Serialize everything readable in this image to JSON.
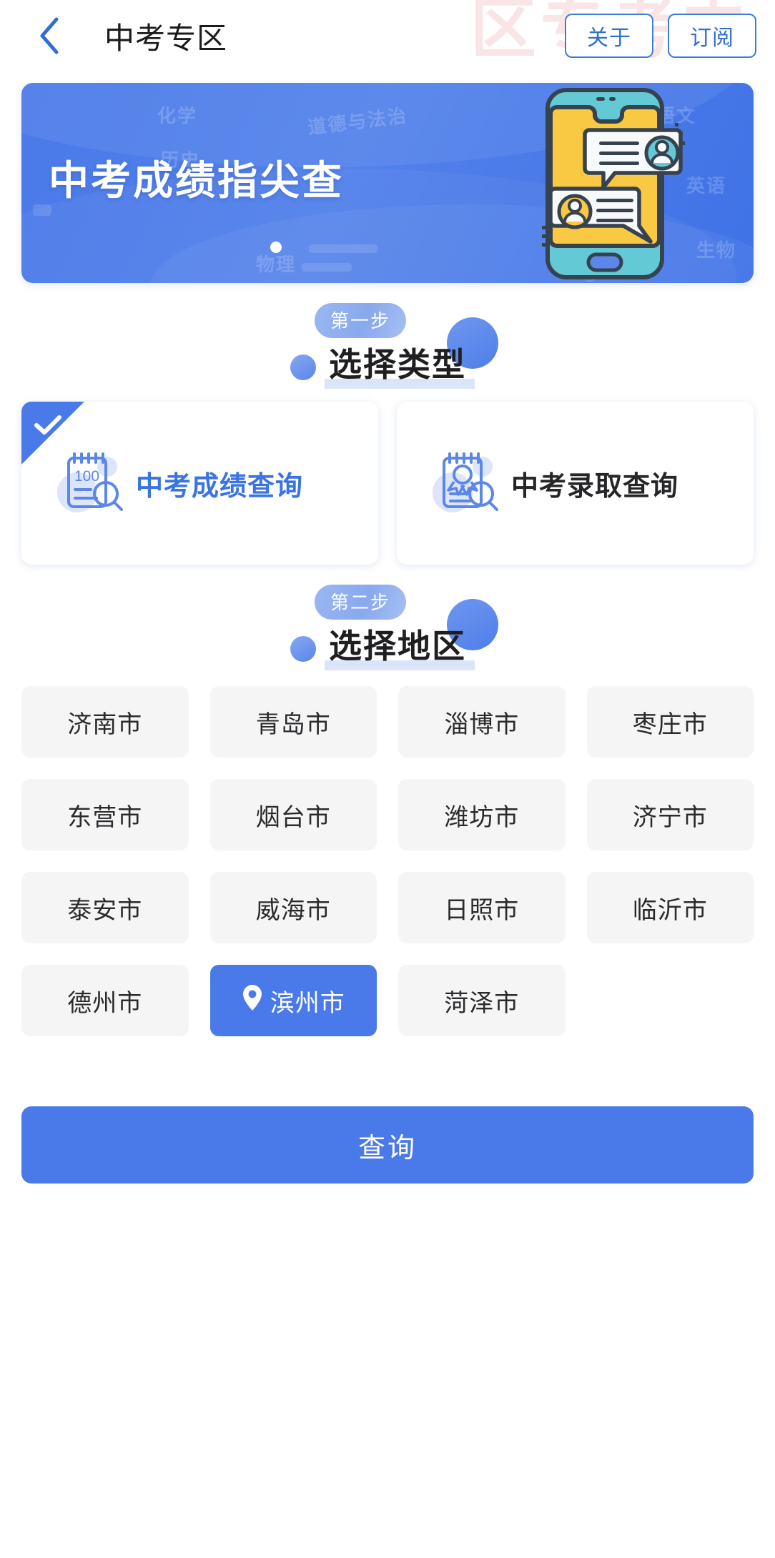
{
  "header": {
    "back_icon": "chevron-left-icon",
    "title": "中考专区",
    "about_label": "关于",
    "subscribe_label": "订阅",
    "watermark_text": "区专考中",
    "accent_color": "#3d7cdb"
  },
  "banner": {
    "title": "中考成绩指尖查",
    "background_color": "#4a7ae9",
    "dot_count": 1,
    "active_dot_index": 0,
    "subject_watermarks": [
      "化学",
      "道德与法治",
      "语文",
      "历史",
      "英语",
      "物理",
      "生物"
    ],
    "illustration": "phone-chat-illustration"
  },
  "steps": [
    {
      "badge": "第一步",
      "title": "选择类型",
      "underline_color": "#9ebaf0"
    },
    {
      "badge": "第二步",
      "title": "选择地区",
      "underline_color": "#9ebaf0"
    }
  ],
  "type_options": [
    {
      "label": "中考成绩查询",
      "icon": "notepad-score-search-icon",
      "icon_badge": "100",
      "selected": true,
      "selected_color": "#4a7ae9",
      "text_color": "#3a74e2"
    },
    {
      "label": "中考录取查询",
      "icon": "notepad-award-search-icon",
      "icon_badge": "",
      "selected": false,
      "text_color": "#262628"
    }
  ],
  "cities": [
    {
      "name": "济南市",
      "selected": false
    },
    {
      "name": "青岛市",
      "selected": false
    },
    {
      "name": "淄博市",
      "selected": false
    },
    {
      "name": "枣庄市",
      "selected": false
    },
    {
      "name": "东营市",
      "selected": false
    },
    {
      "name": "烟台市",
      "selected": false
    },
    {
      "name": "潍坊市",
      "selected": false
    },
    {
      "name": "济宁市",
      "selected": false
    },
    {
      "name": "泰安市",
      "selected": false
    },
    {
      "name": "威海市",
      "selected": false
    },
    {
      "name": "日照市",
      "selected": false
    },
    {
      "name": "临沂市",
      "selected": false
    },
    {
      "name": "德州市",
      "selected": false
    },
    {
      "name": "滨州市",
      "selected": true
    },
    {
      "name": "菏泽市",
      "selected": false
    }
  ],
  "submit": {
    "label": "查询",
    "color": "#4a7ae9"
  }
}
